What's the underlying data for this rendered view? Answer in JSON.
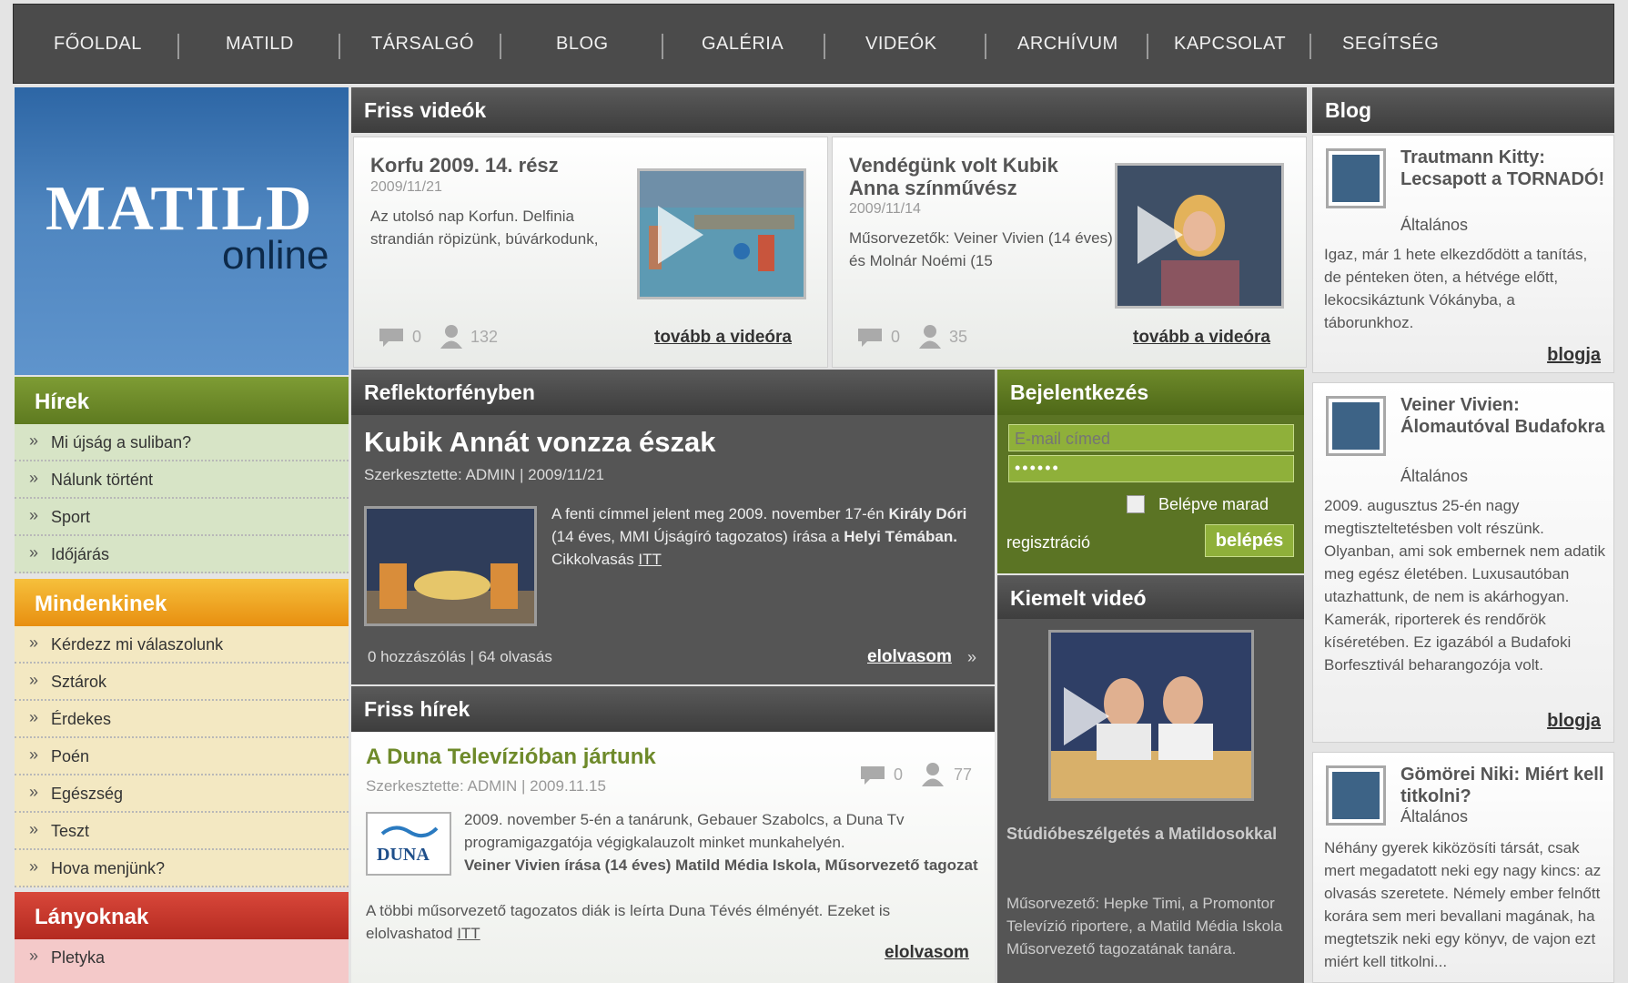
{
  "nav": [
    "FŐOLDAL",
    "MATILD",
    "TÁRSALGÓ",
    "BLOG",
    "GALÉRIA",
    "VIDEÓK",
    "ARCHÍVUM",
    "KAPCSOLAT",
    "SEGÍTSÉG"
  ],
  "logo": {
    "big": "MATILD",
    "small": "online"
  },
  "menus": {
    "hirek": {
      "title": "Hírek",
      "items": [
        "Mi újság a suliban?",
        "Nálunk történt",
        "Sport",
        "Időjárás"
      ]
    },
    "mindenkinek": {
      "title": "Mindenkinek",
      "items": [
        "Kérdezz mi válaszolunk",
        "Sztárok",
        "Érdekes",
        "Poén",
        "Egészség",
        "Teszt",
        "Hova menjünk?"
      ]
    },
    "lanyoknak": {
      "title": "Lányoknak",
      "items": [
        "Pletyka"
      ]
    }
  },
  "friss_videok": {
    "title": "Friss videók",
    "videos": [
      {
        "title": "Korfu 2009. 14. rész",
        "date": "2009/11/21",
        "desc": "Az utolsó nap Korfun. Delfinia strandián röpizünk, búvárkodunk,",
        "comments": "0",
        "views": "132",
        "more": "tovább a videóra"
      },
      {
        "title": "Vendégünk volt Kubik Anna színművész",
        "date": "2009/11/14",
        "desc": "Műsorvezetők: Veiner Vivien (14 éves) és Molnár Noémi (15",
        "comments": "0",
        "views": "35",
        "more": "tovább a videóra"
      }
    ]
  },
  "reflektor": {
    "title": "Reflektorfényben",
    "headline": "Kubik Annát vonzza észak",
    "byline": "Szerkesztette: ADMIN | 2009/11/21",
    "text_intro": "A fenti címmel jelent meg 2009. november 17-én ",
    "text_author": "Király Dóri",
    "text_mid": " (14 éves, MMI Újságíró tagozatos) írása a ",
    "text_paper": "Helyi Témában.",
    "text_read": " Cikkolvasás ",
    "text_link": "ITT",
    "stats": "0 hozzászólás | 64 olvasás",
    "more": "elolvasom",
    "more_arrow": "»"
  },
  "friss_hirek": {
    "title": "Friss hírek",
    "headline": "A Duna Televízióban jártunk",
    "byline": "Szerkesztette: ADMIN | 2009.11.15",
    "comments": "0",
    "views": "77",
    "logo_text": "DUNA",
    "text1": "2009. november 5-én a tanárunk, Gebauer Szabolcs, a Duna Tv programigazgatója végigkalauzolt minket munkahelyén.",
    "text_bold": "Veiner Vivien írása (14 éves) Matild Média Iskola, Műsorvezető tagozat",
    "text2": "A többi műsorvezető tagozatos diák is leírta Duna Tévés élményét. Ezeket is elolvashatod ",
    "text_link": "ITT",
    "more": "elolvasom"
  },
  "login": {
    "title": "Bejelentkezés",
    "email_placeholder": "E-mail címed",
    "password_value": "••••••",
    "remember": "Belépve marad",
    "register": "regisztráció",
    "button": "belépés"
  },
  "featured": {
    "title": "Kiemelt videó",
    "video_title": "Stúdióbeszélgetés a Matildosokkal",
    "desc": "Műsorvezető: Hepke Timi, a Promontor Televízió riportere, a Matild Média Iskola Műsorvezető tagozatának tanára."
  },
  "blog": {
    "title": "Blog",
    "posts": [
      {
        "title": "Trautmann Kitty: Lecsapott a TORNADÓ!",
        "category": "Általános",
        "text": "Igaz, már 1 hete elkezdődött a tanítás, de pénteken öten, a hétvége előtt, lekocsikáztunk Vókányba, a táborunkhoz.",
        "link": "blogja"
      },
      {
        "title": "Veiner Vivien: Álomautóval Budafokra",
        "category": "Általános",
        "text": "2009. augusztus 25-én nagy megtiszteltetésben volt részünk. Olyanban, ami sok embernek nem adatik meg egész életében. Luxusautóban utazhattunk, de nem is akárhogyan. Kamerák, riporterek és rendőrök kíséretében. Ez igazából a Budafoki Borfesztivál beharangozója volt.",
        "link": "blogja"
      },
      {
        "title": "Gömörei Niki: Miért kell titkolni?",
        "category": "Általános",
        "text": "Néhány gyerek kiközösíti társát, csak mert megadatott neki egy nagy kincs: az olvasás szeretete. Némely ember felnőtt korára sem meri bevallani magának, ha megtetszik neki egy könyv, de vajon ezt miért kell titkolni...",
        "link": "blogja"
      }
    ]
  },
  "colors": {
    "hirek": "#6e8a2a",
    "mindenkinek": "#f0a81a",
    "lanyoknak": "#c73a2e",
    "logo": "#4f86c0"
  }
}
